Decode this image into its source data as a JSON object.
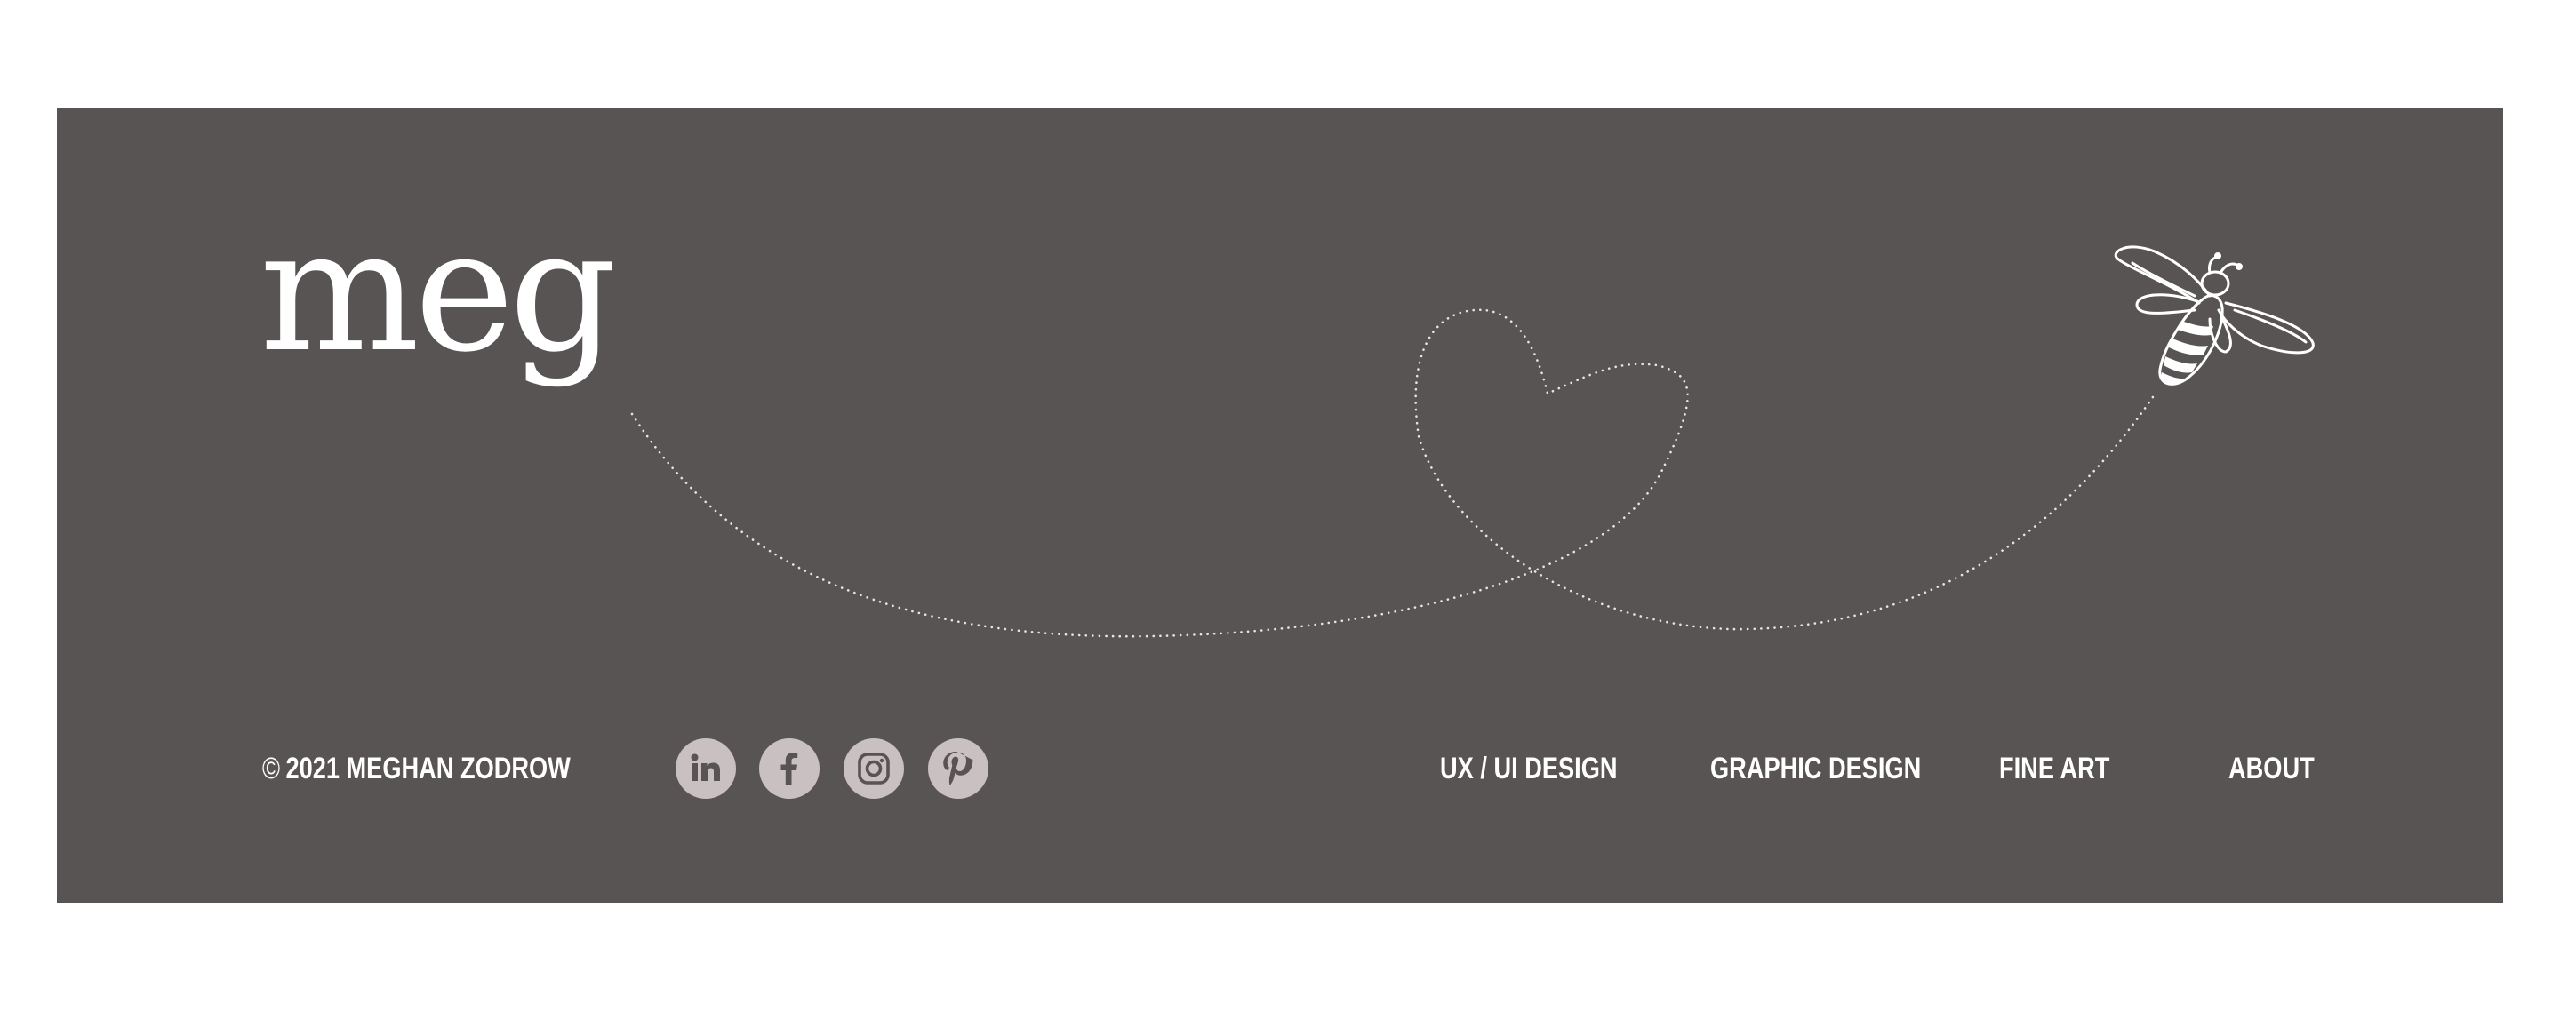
{
  "brand": {
    "logo_text": "meg"
  },
  "footer": {
    "copyright_symbol": "©",
    "copyright_text": "2021 MEGHAN ZODROW",
    "background_color": "#585453"
  },
  "social": [
    {
      "name": "LinkedIn",
      "icon": "linkedin-icon"
    },
    {
      "name": "Facebook",
      "icon": "facebook-icon"
    },
    {
      "name": "Instagram",
      "icon": "instagram-icon"
    },
    {
      "name": "Pinterest",
      "icon": "pinterest-icon"
    }
  ],
  "nav": {
    "ux_ui_design": "UX / UI DESIGN",
    "graphic_design": "GRAPHIC DESIGN",
    "fine_art": "FINE ART",
    "about": "ABOUT"
  },
  "decorations": {
    "flight_path": "dotted-heart-path",
    "bee": "bee-icon"
  },
  "colors": {
    "text": "#ffffff",
    "icon_circle": "#c9c1c1",
    "icon_glyph": "#585453"
  }
}
